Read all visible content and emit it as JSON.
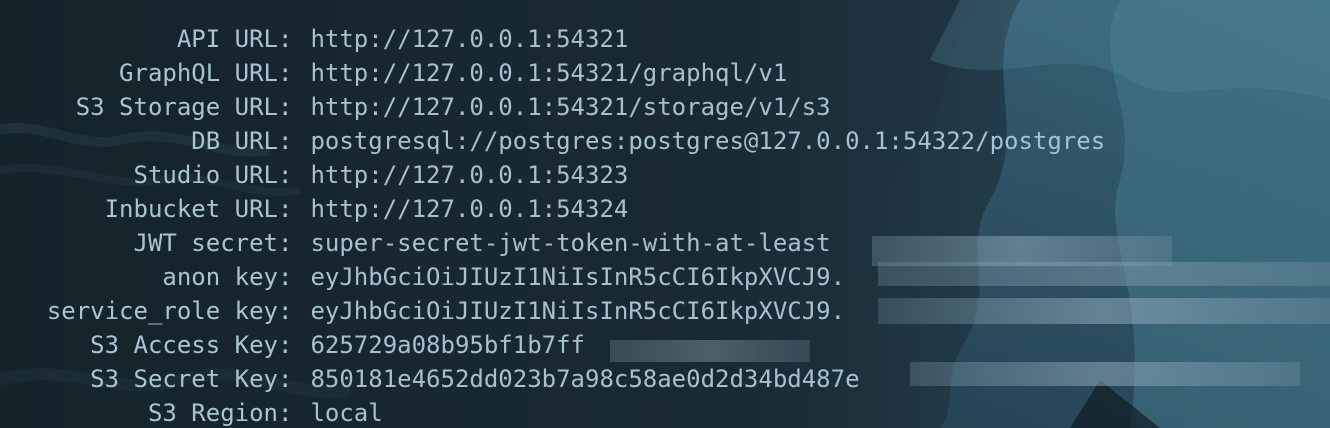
{
  "terminal": {
    "rows": [
      {
        "key": "API URL",
        "value": "http://127.0.0.1:54321"
      },
      {
        "key": "GraphQL URL",
        "value": "http://127.0.0.1:54321/graphql/v1"
      },
      {
        "key": "S3 Storage URL",
        "value": "http://127.0.0.1:54321/storage/v1/s3"
      },
      {
        "key": "DB URL",
        "value": "postgresql://postgres:postgres@127.0.0.1:54322/postgres"
      },
      {
        "key": "Studio URL",
        "value": "http://127.0.0.1:54323"
      },
      {
        "key": "Inbucket URL",
        "value": "http://127.0.0.1:54324"
      },
      {
        "key": "JWT secret",
        "value": "super-secret-jwt-token-with-at-least"
      },
      {
        "key": "anon key",
        "value": "eyJhbGciOiJIUzI1NiIsInR5cCI6IkpXVCJ9."
      },
      {
        "key": "service_role key",
        "value": "eyJhbGciOiJIUzI1NiIsInR5cCI6IkpXVCJ9."
      },
      {
        "key": "S3 Access Key",
        "value": "625729a08b95bf1b7ff"
      },
      {
        "key": "S3 Secret Key",
        "value": "850181e4652dd023b7a98c58ae0d2d34bd487e"
      },
      {
        "key": "S3 Region",
        "value": "local"
      }
    ],
    "colors": {
      "background": "#18262e",
      "text": "#a9c4d3",
      "wallpaper_accent": "#2f5d72"
    }
  }
}
